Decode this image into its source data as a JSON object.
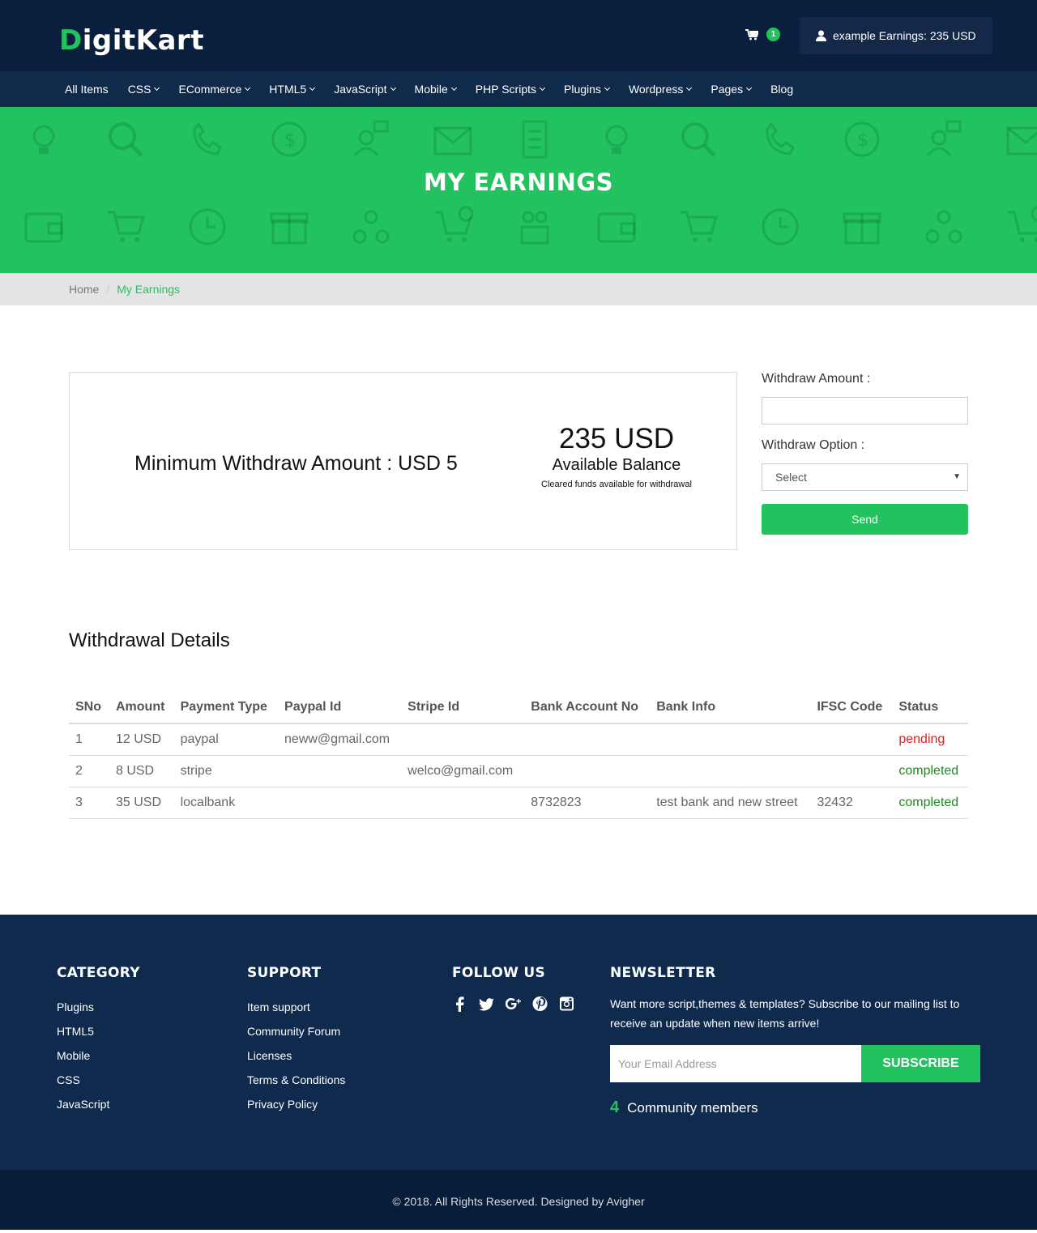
{
  "brand": {
    "first_letter": "D",
    "rest": "igitKart",
    "accent": "#22c25f"
  },
  "header": {
    "cart_count": "1",
    "user_text": "example Earnings: 235 USD"
  },
  "nav": {
    "items": [
      {
        "label": "All Items",
        "dropdown": false
      },
      {
        "label": "CSS",
        "dropdown": true
      },
      {
        "label": "ECommerce",
        "dropdown": true
      },
      {
        "label": "HTML5",
        "dropdown": true
      },
      {
        "label": "JavaScript",
        "dropdown": true
      },
      {
        "label": "Mobile",
        "dropdown": true
      },
      {
        "label": "PHP Scripts",
        "dropdown": true
      },
      {
        "label": "Plugins",
        "dropdown": true
      },
      {
        "label": "Wordpress",
        "dropdown": true
      },
      {
        "label": "Pages",
        "dropdown": true
      },
      {
        "label": "Blog",
        "dropdown": false
      }
    ]
  },
  "hero": {
    "title": "MY EARNINGS"
  },
  "breadcrumb": {
    "home": "Home",
    "separator": "/",
    "current": "My Earnings"
  },
  "balance": {
    "min_withdraw": "Minimum Withdraw Amount : USD 5",
    "amount": "235 USD",
    "label": "Available Balance",
    "note": "Cleared funds available for withdrawal"
  },
  "withdraw_form": {
    "amount_label": "Withdraw Amount :",
    "amount_value": "",
    "option_label": "Withdraw Option :",
    "option_selected": "Select",
    "send_label": "Send"
  },
  "withdrawals": {
    "title": "Withdrawal Details",
    "columns": [
      "SNo",
      "Amount",
      "Payment Type",
      "Paypal Id",
      "Stripe Id",
      "Bank Account No",
      "Bank Info",
      "IFSC Code",
      "Status"
    ],
    "rows": [
      {
        "sno": "1",
        "amount": "12 USD",
        "payment_type": "paypal",
        "paypal_id": "neww@gmail.com",
        "stripe_id": "",
        "bank_account": "",
        "bank_info": "",
        "ifsc": "",
        "status": "pending"
      },
      {
        "sno": "2",
        "amount": "8 USD",
        "payment_type": "stripe",
        "paypal_id": "",
        "stripe_id": "welco@gmail.com",
        "bank_account": "",
        "bank_info": "",
        "ifsc": "",
        "status": "completed"
      },
      {
        "sno": "3",
        "amount": "35 USD",
        "payment_type": "localbank",
        "paypal_id": "",
        "stripe_id": "",
        "bank_account": "8732823",
        "bank_info": "test bank and new street",
        "ifsc": "32432",
        "status": "completed"
      }
    ],
    "status_colors": {
      "pending": "#e02020",
      "completed": "#1e8a1e"
    }
  },
  "footer": {
    "category": {
      "title": "CATEGORY",
      "links": [
        "Plugins",
        "HTML5",
        "Mobile",
        "CSS",
        "JavaScript"
      ]
    },
    "support": {
      "title": "SUPPORT",
      "links": [
        "Item support",
        "Community Forum",
        "Licenses",
        "Terms & Conditions",
        "Privacy Policy"
      ]
    },
    "follow": {
      "title": "FOLLOW US",
      "icons": [
        "facebook-icon",
        "twitter-icon",
        "google-plus-icon",
        "pinterest-icon",
        "instagram-icon"
      ]
    },
    "newsletter": {
      "title": "NEWSLETTER",
      "text": "Want more script,themes & templates? Subscribe to our mailing list to receive an update when new items arrive!",
      "email_placeholder": "Your Email Address",
      "button": "SUBSCRIBE",
      "community_count": "4",
      "community_label": "Community members"
    },
    "copyright": "© 2018. All Rights Reserved. Designed by Avigher"
  }
}
